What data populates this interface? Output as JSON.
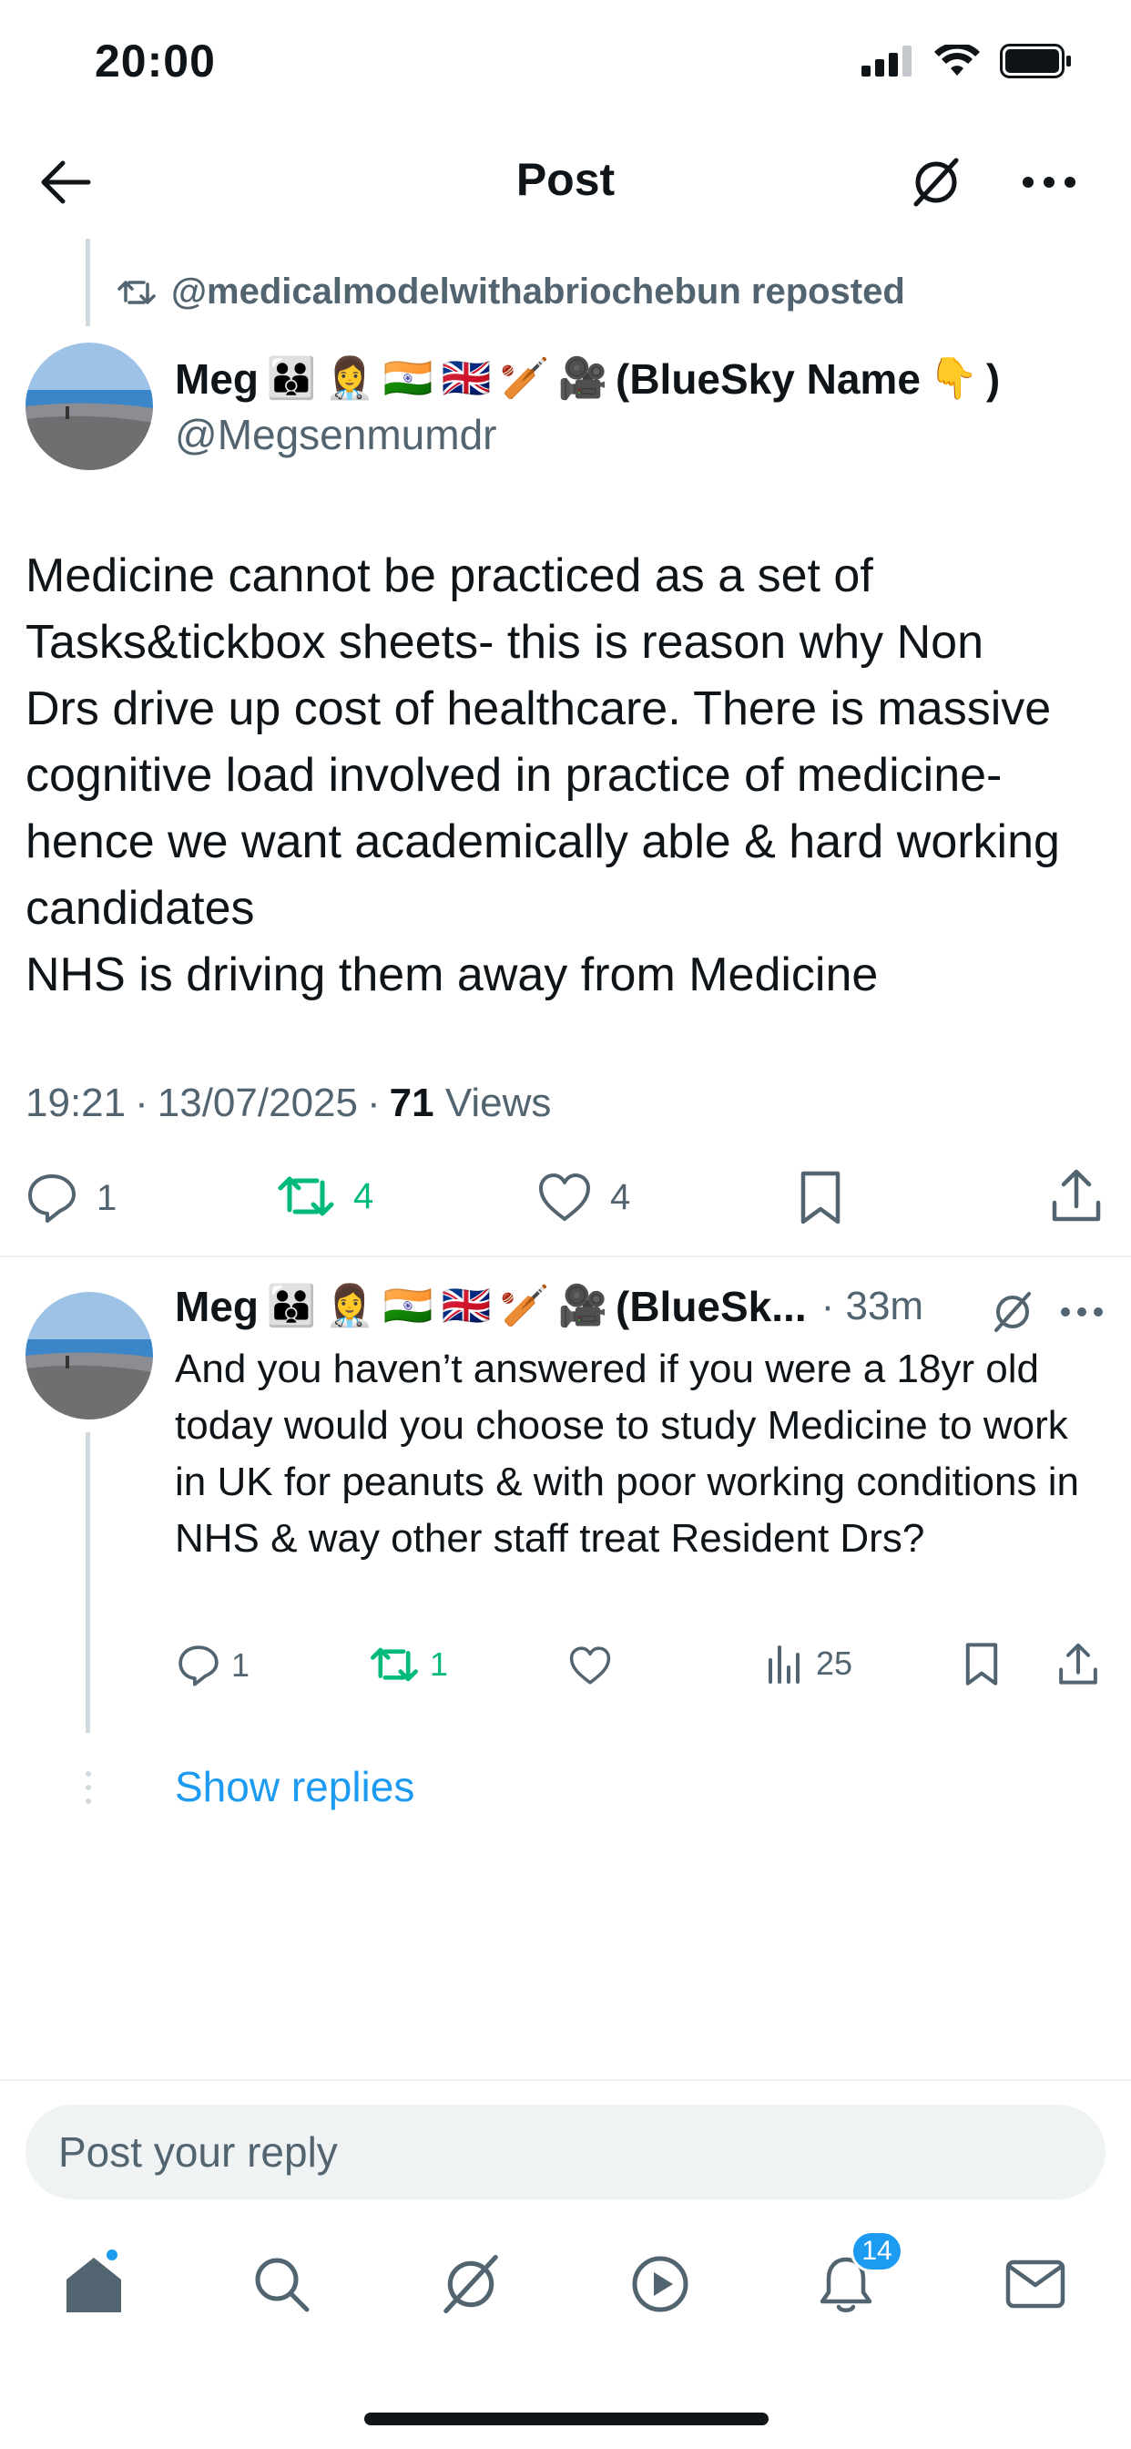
{
  "status_bar": {
    "time": "20:00"
  },
  "header": {
    "title": "Post"
  },
  "repost": {
    "text": "@medicalmodelwithabriochebun reposted"
  },
  "main_post": {
    "author_name": "Meg",
    "author_suffix": "(BlueSky Name",
    "author_suffix_end": ")",
    "handle": "@Megsenmumdr",
    "text": "Medicine cannot be practiced as a set of\nTasks&tickbox sheets- this is reason why Non\nDrs drive up cost of healthcare. There is massive\ncognitive load involved in practice of medicine-\nhence we want academically able & hard working\ncandidates\nNHS is driving them away from Medicine",
    "time": "19:21",
    "date": "13/07/2025",
    "views_count": "71",
    "views_label": "Views",
    "replies": "1",
    "reposts": "4",
    "likes": "4"
  },
  "reply_post": {
    "author_name": "Meg",
    "author_trunc": "(BlueSk...",
    "time": "· 33m",
    "text": "And you haven’t answered if you were a 18yr old today would you choose to study Medicine to work in UK for peanuts & with poor working conditions in NHS & way other staff treat Resident Drs?",
    "replies": "1",
    "reposts": "1",
    "likes": "",
    "views": "25"
  },
  "show_replies_label": "Show replies",
  "composer": {
    "placeholder": "Post your reply"
  },
  "bottom_nav": {
    "notifications_badge": "14"
  },
  "colors": {
    "accent": "#1d9bf0",
    "repost_green": "#00ba7c",
    "muted": "#536471"
  }
}
